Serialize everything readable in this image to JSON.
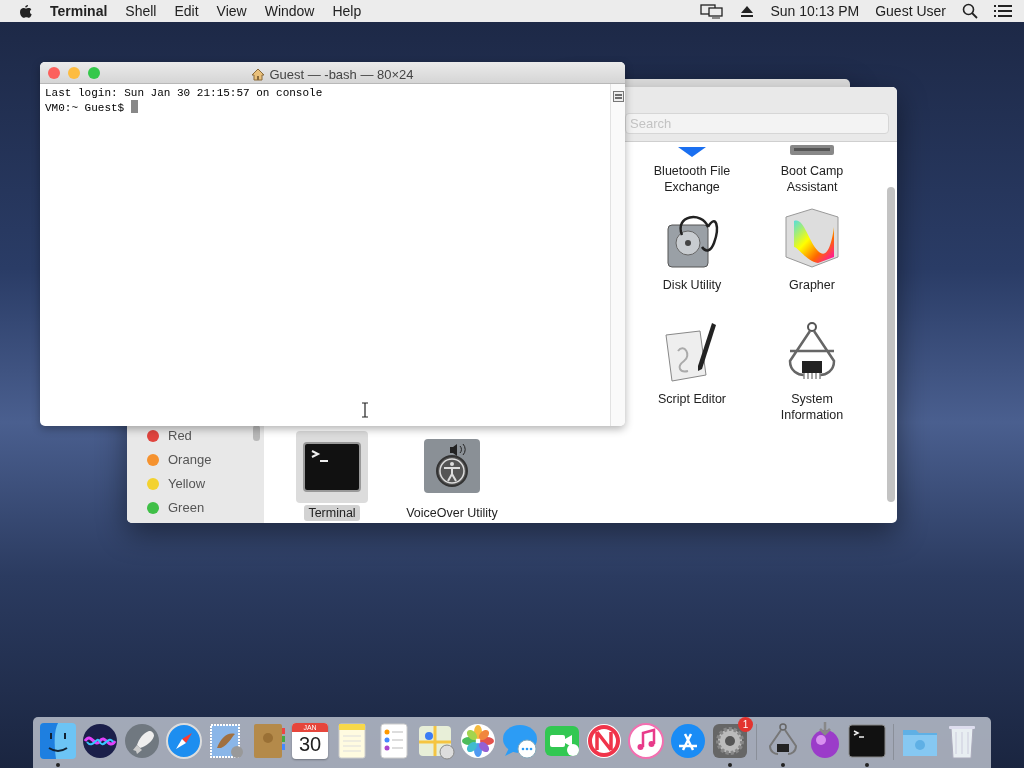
{
  "menu_bar": {
    "app_name": "Terminal",
    "menus": [
      "Shell",
      "Edit",
      "View",
      "Window",
      "Help"
    ],
    "clock": "Sun 10:13 PM",
    "user": "Guest User"
  },
  "finder_window": {
    "search": {
      "placeholder": "Search"
    },
    "sidebar_tags": [
      {
        "label": "Red",
        "color": "#e0443e"
      },
      {
        "label": "Orange",
        "color": "#f5922f"
      },
      {
        "label": "Yellow",
        "color": "#f3d22f"
      },
      {
        "label": "Green",
        "color": "#3fbf47"
      }
    ],
    "app_rows": [
      [
        null,
        null,
        null,
        {
          "label": "Bluetooth File Exchange",
          "selected": false
        },
        {
          "label": "Boot Camp Assistant",
          "selected": false
        }
      ],
      [
        null,
        null,
        null,
        {
          "label": "Disk Utility",
          "selected": false
        },
        {
          "label": "Grapher",
          "selected": false
        }
      ],
      [
        null,
        null,
        null,
        {
          "label": "Script Editor",
          "selected": false
        },
        {
          "label": "System Information",
          "selected": false
        }
      ],
      [
        {
          "label": "Terminal",
          "selected": true
        },
        {
          "label": "VoiceOver Utility",
          "selected": false
        },
        null,
        null,
        null
      ]
    ]
  },
  "terminal_window": {
    "title": "Guest — -bash — 80×24",
    "lines": [
      "Last login: Sun Jan 30 21:15:57 on console",
      "VM0:~ Guest$ "
    ]
  },
  "dock": {
    "calendar": {
      "month": "JAN",
      "day": "30"
    },
    "items": [
      {
        "running": true
      },
      {
        "running": false
      },
      {
        "running": false
      },
      {
        "running": false
      },
      {
        "running": false
      },
      {
        "running": false
      },
      {
        "running": false
      },
      {
        "running": false
      },
      {
        "running": false
      },
      {
        "running": false
      },
      {
        "running": false
      },
      {
        "running": false
      },
      {
        "running": false
      },
      {
        "running": false
      },
      {
        "running": false
      },
      {
        "running": false
      },
      {
        "running": true,
        "badge": "1"
      },
      {
        "running": true
      },
      {
        "running": false
      },
      {
        "running": true
      },
      {
        "running": false
      },
      {
        "running": false
      }
    ]
  }
}
